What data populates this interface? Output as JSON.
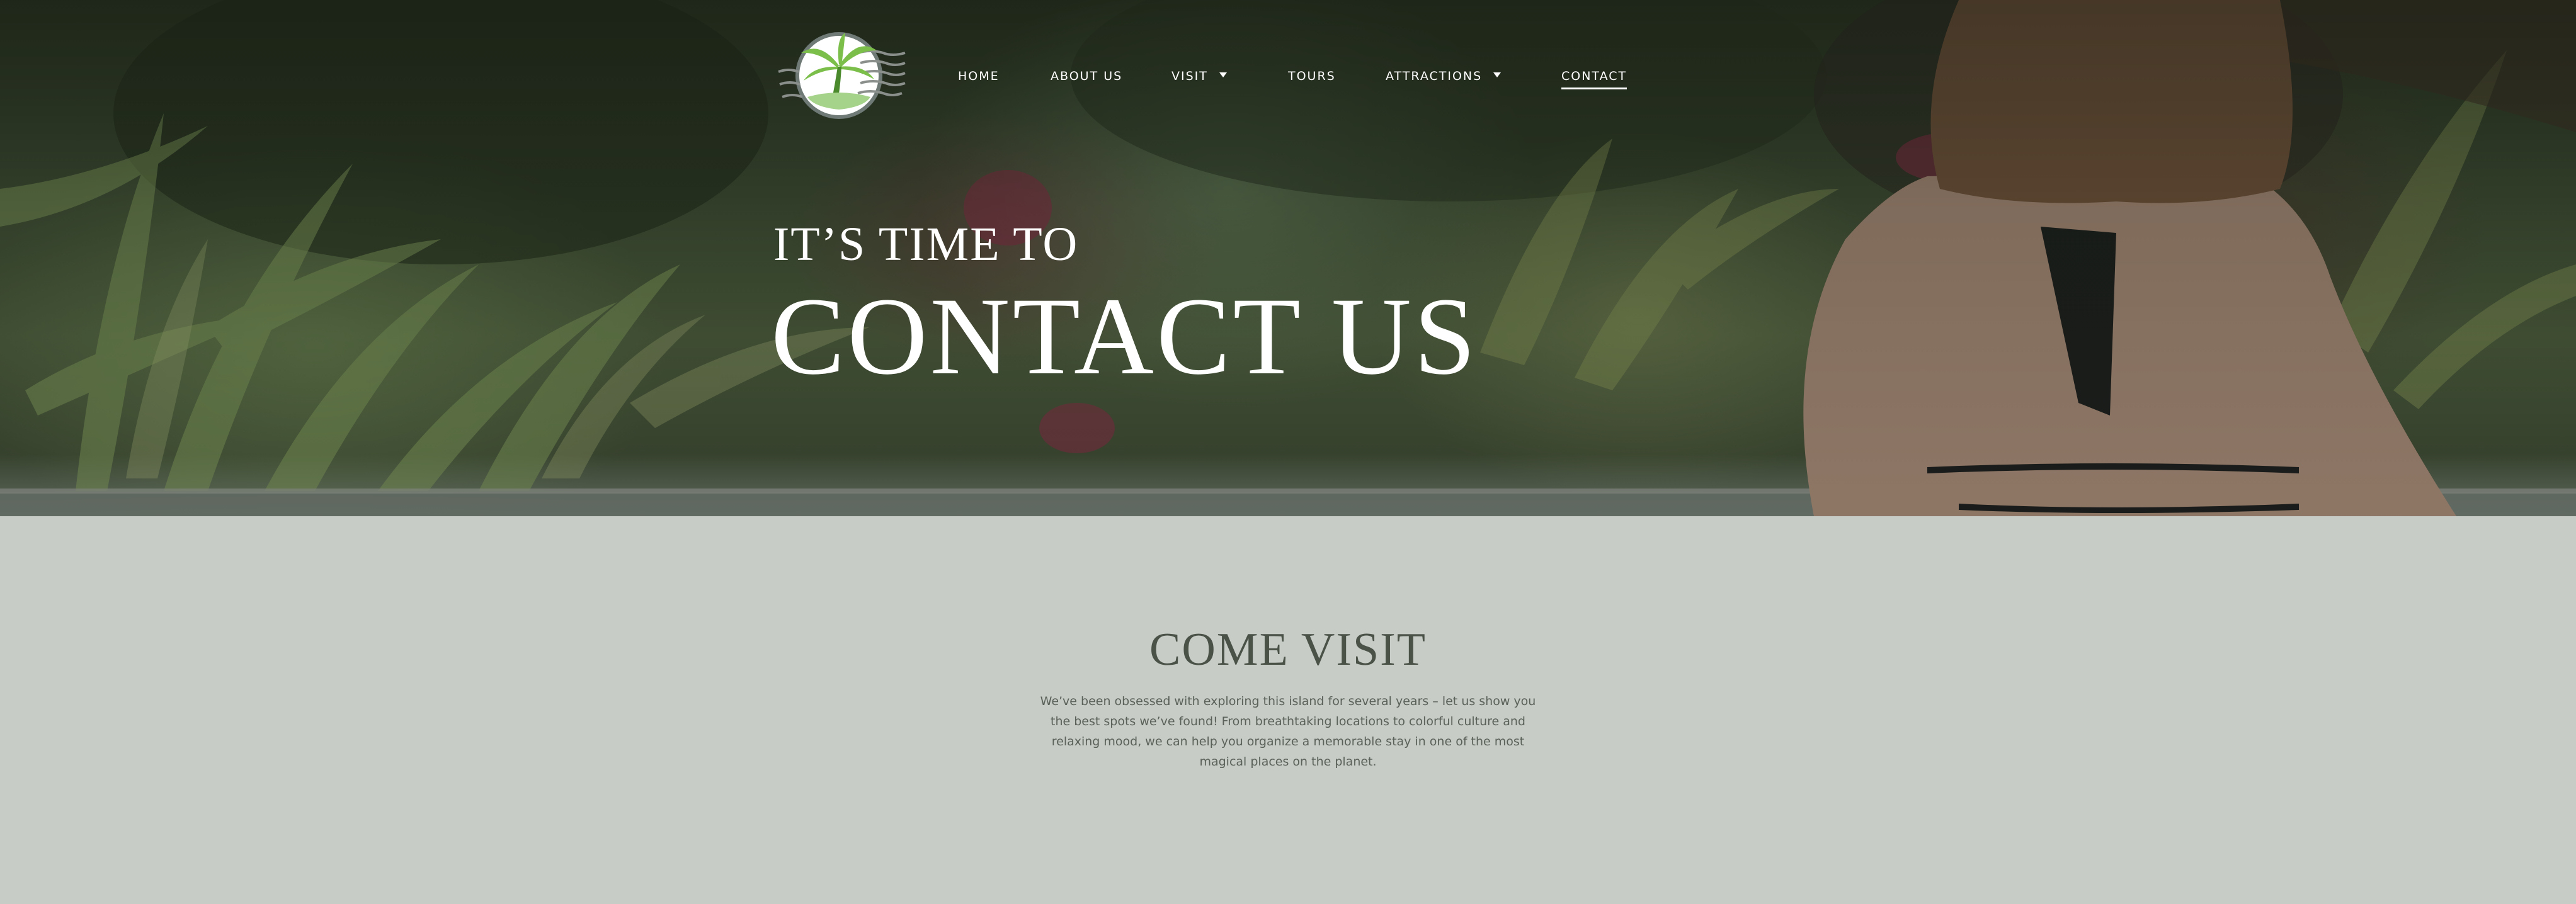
{
  "nav": {
    "logo_icon": "palm-tree-stamp-icon",
    "items": [
      {
        "label": "HOME",
        "has_dropdown": false,
        "active": false
      },
      {
        "label": "ABOUT US",
        "has_dropdown": false,
        "active": false
      },
      {
        "label": "VISIT",
        "has_dropdown": true,
        "active": false
      },
      {
        "label": "TOURS",
        "has_dropdown": false,
        "active": false
      },
      {
        "label": "ATTRACTIONS",
        "has_dropdown": true,
        "active": false
      },
      {
        "label": "CONTACT",
        "has_dropdown": false,
        "active": true
      }
    ]
  },
  "hero": {
    "kicker": "IT’S TIME TO",
    "title": "CONTACT US"
  },
  "section": {
    "title": "COME VISIT",
    "body": "We’ve been obsessed with exploring this island for several years – let us show you the best spots we’ve found! From breathtaking locations to colorful culture and relaxing mood, we can help you organize a memorable stay in one of the most magical places on the planet."
  },
  "colors": {
    "content_background": "#c7ccc7",
    "heading_text": "#4a5248",
    "body_text": "#5a6158",
    "logo_green": "#7bbf4a"
  }
}
